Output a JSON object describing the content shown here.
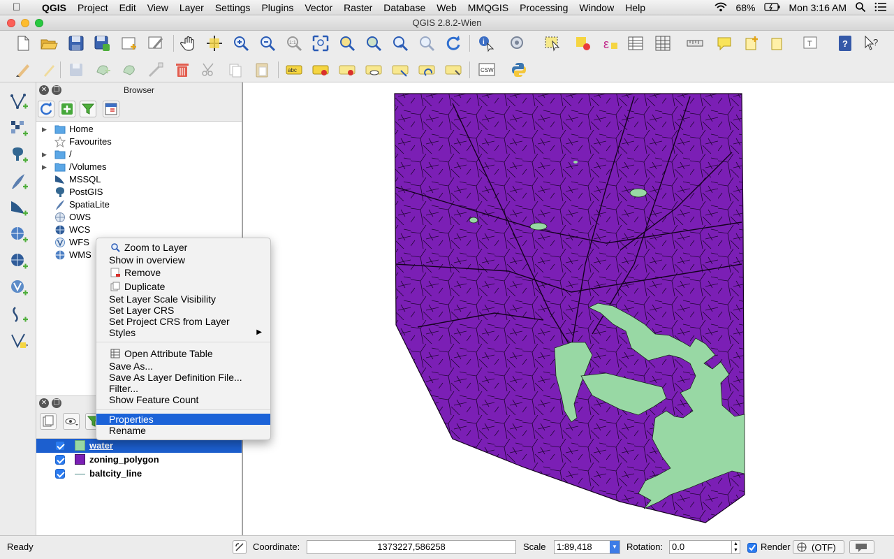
{
  "menubar": {
    "apple": "",
    "items": [
      "QGIS",
      "Project",
      "Edit",
      "View",
      "Layer",
      "Settings",
      "Plugins",
      "Vector",
      "Raster",
      "Database",
      "Web",
      "MMQGIS",
      "Processing",
      "Window",
      "Help"
    ],
    "battery": "68%",
    "clock": "Mon 3:16 AM"
  },
  "window": {
    "title": "QGIS 2.8.2-Wien"
  },
  "browser": {
    "title": "Browser",
    "items": [
      "Home",
      "Favourites",
      "/",
      "/Volumes",
      "MSSQL",
      "PostGIS",
      "SpatiaLite",
      "OWS",
      "WCS",
      "WFS",
      "WMS"
    ]
  },
  "layers": {
    "items": [
      "water",
      "zoning_polygon",
      "baltcity_line"
    ],
    "selected": "water",
    "colors": {
      "water": "#98d8a4",
      "zoning_polygon": "#7b1fb5",
      "baltcity_line": "#4a8a86"
    }
  },
  "context_menu": {
    "items": [
      "Zoom to Layer",
      "Show in overview",
      "Remove",
      "Duplicate",
      "Set Layer Scale Visibility",
      "Set Layer CRS",
      "Set Project CRS from Layer",
      "Styles",
      "Open Attribute Table",
      "Save As...",
      "Save As Layer Definition File...",
      "Filter...",
      "Show Feature Count",
      "Properties",
      "Rename"
    ],
    "highlighted": "Properties"
  },
  "status": {
    "ready": "Ready",
    "coordinate_label": "Coordinate:",
    "coordinate_value": "1373227,586258",
    "scale_label": "Scale",
    "scale_value": "1:89,418",
    "rotation_label": "Rotation:",
    "rotation_value": "0.0",
    "render_label": "Render",
    "crs": "(OTF)"
  },
  "toolbar2": {
    "csw_label": "CSW",
    "abc_label": "abc"
  },
  "map": {
    "fill_color": "#7b1fb5",
    "water_color": "#98d8a4",
    "background": "#ffffff"
  }
}
